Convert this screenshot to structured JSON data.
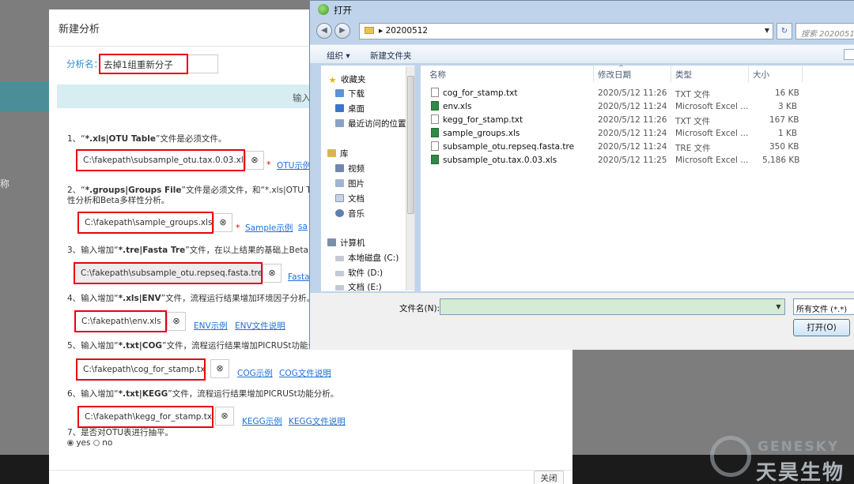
{
  "backdrop": {
    "side_text": "称"
  },
  "modal": {
    "title": "新建分析",
    "name_label": "分析名：",
    "name_value": "去掉1组重新分子",
    "banner_text": "输入",
    "close_label": "关闭",
    "steps": [
      {
        "pre": "1、“",
        "bold": "*.xls|OTU Table",
        "post": "”文件是必须文件。",
        "field": "C:\\fakepath\\subsample_otu.tax.0.03.xls",
        "required": "*",
        "links": [
          "OTU示例"
        ]
      },
      {
        "pre": "2、“",
        "bold": "*.groups|Groups File",
        "post": "”文件是必须文件，和“*.xls|OTU Ta",
        "line2": "性分析和Beta多样性分析。",
        "field": "C:\\fakepath\\sample_groups.xls",
        "required": "*",
        "links": [
          "Sample示例",
          "sa"
        ]
      },
      {
        "pre": "3、输入增加“",
        "bold": "*.tre|Fasta Tre",
        "post": "”文件，在以上结果的基础上Beta多",
        "field": "C:\\fakepath\\subsample_otu.repseq.fasta.tre",
        "links": [
          "Fasta"
        ]
      },
      {
        "pre": "4、输入增加“",
        "bold": "*.xls|ENV",
        "post": "”文件，流程运行结果增加环境因子分析。",
        "field": "C:\\fakepath\\env.xls",
        "links": [
          "ENV示例",
          "ENV文件说明"
        ]
      },
      {
        "pre": "5、输入增加“",
        "bold": "*.txt|COG",
        "post": "”文件，流程运行结果增加PICRUSt功能分",
        "field": "C:\\fakepath\\cog_for_stamp.txt",
        "links": [
          "COG示例",
          "COG文件说明"
        ]
      },
      {
        "pre": "6、输入增加“",
        "bold": "*.txt|KEGG",
        "post": "”文件，流程运行结果增加PICRUSt功能分析。",
        "field": "C:\\fakepath\\kegg_for_stamp.txt",
        "links": [
          "KEGG示例",
          "KEGG文件说明"
        ]
      }
    ],
    "step7": {
      "label": "7、是否对OTU表进行抽平。",
      "options": [
        "yes",
        "no"
      ],
      "selected": "yes"
    },
    "clear_glyph": "⊗"
  },
  "dialog": {
    "title": "打开",
    "path": "20200512",
    "path_arrow": "▸",
    "search_placeholder": "搜索 20200512",
    "toolbar": {
      "organize": "组织 ▾",
      "new_folder": "新建文件夹"
    },
    "nav": {
      "favorites": "收藏夹",
      "downloads": "下载",
      "desktop": "桌面",
      "recent": "最近访问的位置",
      "libraries": "库",
      "videos": "视频",
      "pictures": "图片",
      "documents": "文档",
      "music": "音乐",
      "computer": "计算机",
      "drive_c": "本地磁盘 (C:)",
      "drive_d": "软件 (D:)",
      "drive_e": "文档 (E:)"
    },
    "columns": {
      "name": "名称",
      "date": "修改日期",
      "type": "类型",
      "size": "大小"
    },
    "files": [
      {
        "name": "cog_for_stamp.txt",
        "date": "2020/5/12 11:26",
        "type": "TXT 文件",
        "size": "16 KB",
        "icon": "text-file-icon"
      },
      {
        "name": "env.xls",
        "date": "2020/5/12 11:24",
        "type": "Microsoft Excel ...",
        "size": "3 KB",
        "icon": "excel-file-icon"
      },
      {
        "name": "kegg_for_stamp.txt",
        "date": "2020/5/12 11:26",
        "type": "TXT 文件",
        "size": "167 KB",
        "icon": "text-file-icon"
      },
      {
        "name": "sample_groups.xls",
        "date": "2020/5/12 11:24",
        "type": "Microsoft Excel ...",
        "size": "1 KB",
        "icon": "excel-file-icon"
      },
      {
        "name": "subsample_otu.repseq.fasta.tre",
        "date": "2020/5/12 11:24",
        "type": "TRE 文件",
        "size": "350 KB",
        "icon": "text-file-icon"
      },
      {
        "name": "subsample_otu.tax.0.03.xls",
        "date": "2020/5/12 11:25",
        "type": "Microsoft Excel ...",
        "size": "5,186 KB",
        "icon": "excel-file-icon"
      }
    ],
    "filename_label": "文件名(N):",
    "filename_value": "",
    "filetype": "所有文件 (*.*)",
    "open_label": "打开(O)"
  },
  "logo": {
    "en": "GENESKY",
    "cn": "天昊生物"
  },
  "colors": {
    "highlight": "#e8000f",
    "link": "#1e6fd9",
    "accent": "#2f8fcf"
  }
}
